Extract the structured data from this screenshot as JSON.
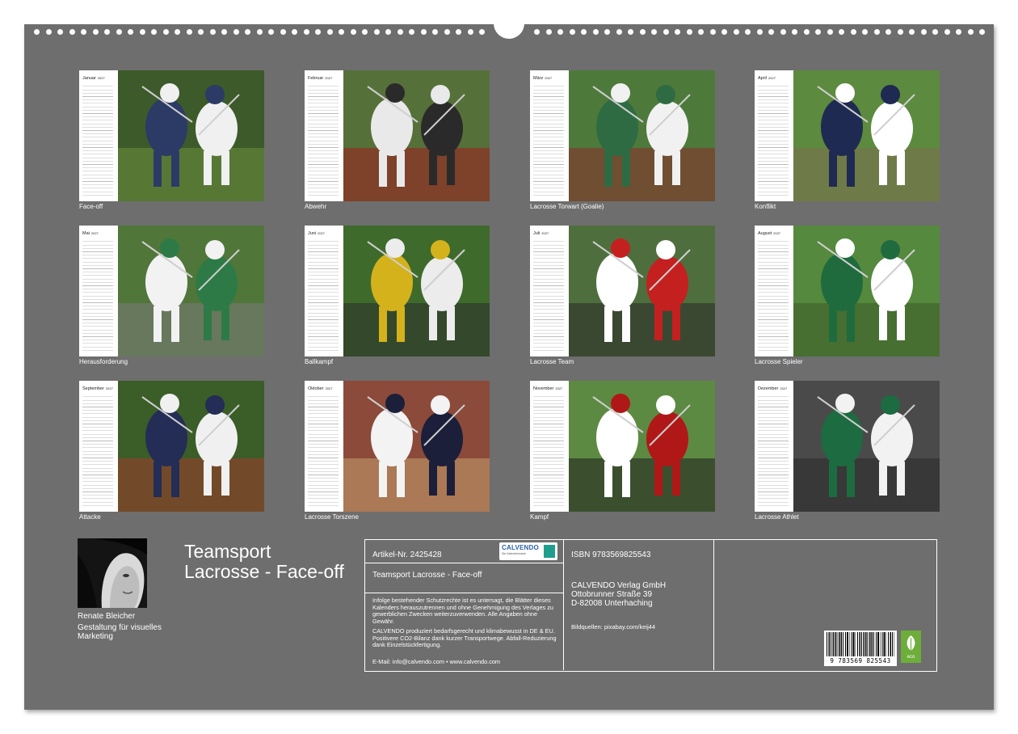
{
  "months": [
    {
      "title": "Januar",
      "year": "2027",
      "caption": "Face-off",
      "palette": {
        "bg": "#3d5a2a",
        "a": "#2c3a66",
        "b": "#f0f0f0",
        "c": "#6d8f3e"
      }
    },
    {
      "title": "Februar",
      "year": "2027",
      "caption": "Abwehr",
      "palette": {
        "bg": "#56703a",
        "a": "#e9e9e9",
        "b": "#2a2a2a",
        "c": "#a01b1b"
      }
    },
    {
      "title": "März",
      "year": "2027",
      "caption": "Lacrosse Torwart (Goalie)",
      "palette": {
        "bg": "#4d7a3b",
        "a": "#2e6b42",
        "b": "#f1f1f1",
        "c": "#8c2a2a"
      }
    },
    {
      "title": "April",
      "year": "2027",
      "caption": "Konflikt",
      "palette": {
        "bg": "#5c8a3e",
        "a": "#1f2a52",
        "b": "#ffffff",
        "c": "#7f6d52"
      }
    },
    {
      "title": "Mai",
      "year": "2027",
      "caption": "Herausforderung",
      "palette": {
        "bg": "#50763a",
        "a": "#f2f2f2",
        "b": "#2e7a46",
        "c": "#7a7a7a"
      }
    },
    {
      "title": "Juni",
      "year": "2027",
      "caption": "Ballkampf",
      "palette": {
        "bg": "#3e6a2c",
        "a": "#d4b21c",
        "b": "#ececec",
        "c": "#2b2b2b"
      }
    },
    {
      "title": "Juli",
      "year": "2027",
      "caption": "Lacrosse Team",
      "palette": {
        "bg": "#4f6e3d",
        "a": "#ffffff",
        "b": "#c42020",
        "c": "#2a2a2a"
      }
    },
    {
      "title": "August",
      "year": "2027",
      "caption": "Lacrosse Spieler",
      "palette": {
        "bg": "#55893e",
        "a": "#1f6b3e",
        "b": "#ffffff",
        "c": "#3c5a26"
      }
    },
    {
      "title": "September",
      "year": "2027",
      "caption": "Attacke",
      "palette": {
        "bg": "#3b5d28",
        "a": "#232d56",
        "b": "#f0f0f0",
        "c": "#a33a2a"
      }
    },
    {
      "title": "Oktober",
      "year": "2027",
      "caption": "Lacrosse Torszene",
      "palette": {
        "bg": "#8b4a3a",
        "a": "#f3f3f3",
        "b": "#1b1f3a",
        "c": "#c7a06b"
      }
    },
    {
      "title": "November",
      "year": "2027",
      "caption": "Kampf",
      "palette": {
        "bg": "#5d8a42",
        "a": "#ffffff",
        "b": "#b01818",
        "c": "#1f1f1f"
      }
    },
    {
      "title": "Dezember",
      "year": "2027",
      "caption": "Lacrosse Athlet",
      "palette": {
        "bg": "#4a4a4a",
        "a": "#1d6b40",
        "b": "#f2f2f2",
        "c": "#2a2a2a"
      }
    }
  ],
  "author": {
    "name": "Renate Bleicher",
    "role": "Gestaltung für visuelles Marketing"
  },
  "calendar_title": "Teamsport Lacrosse - Face-off",
  "info": {
    "article_no": "Artikel-Nr. 2425428",
    "subtitle": "Teamsport Lacrosse - Face-off",
    "legal_1": "Infolge bestehender Schutzrechte ist es untersagt, die Blätter dieses Kalenders herauszutrennen und ohne Genehmigung des Verlages zu gewerblichen Zwecken weiterzuverwenden. Alle Angaben ohne Gewähr.",
    "legal_2": "CALVENDO produziert bedarfsgerecht und klimabewusst in DE & EU. Positivere CO2-Bilanz dank kurzer Transportwege. Abfall-Reduzierung dank Einzelstückfertigung.",
    "contact": "E-Mail: info@calvendo.com • www.calvendo.com",
    "isbn": "ISBN 9783569825543",
    "publisher_name": "CALVENDO Verlag GmbH",
    "publisher_street": "Ottobrunner Straße 39",
    "publisher_city": "D-82008 Unterhaching",
    "image_sources": "Bildquellen: pixabay.com/keij44",
    "logo_word": "CALVENDO",
    "logo_tagline": "Die Kalendermarke",
    "barcode_number": "9 783569 825543",
    "eco_label": "eco"
  }
}
